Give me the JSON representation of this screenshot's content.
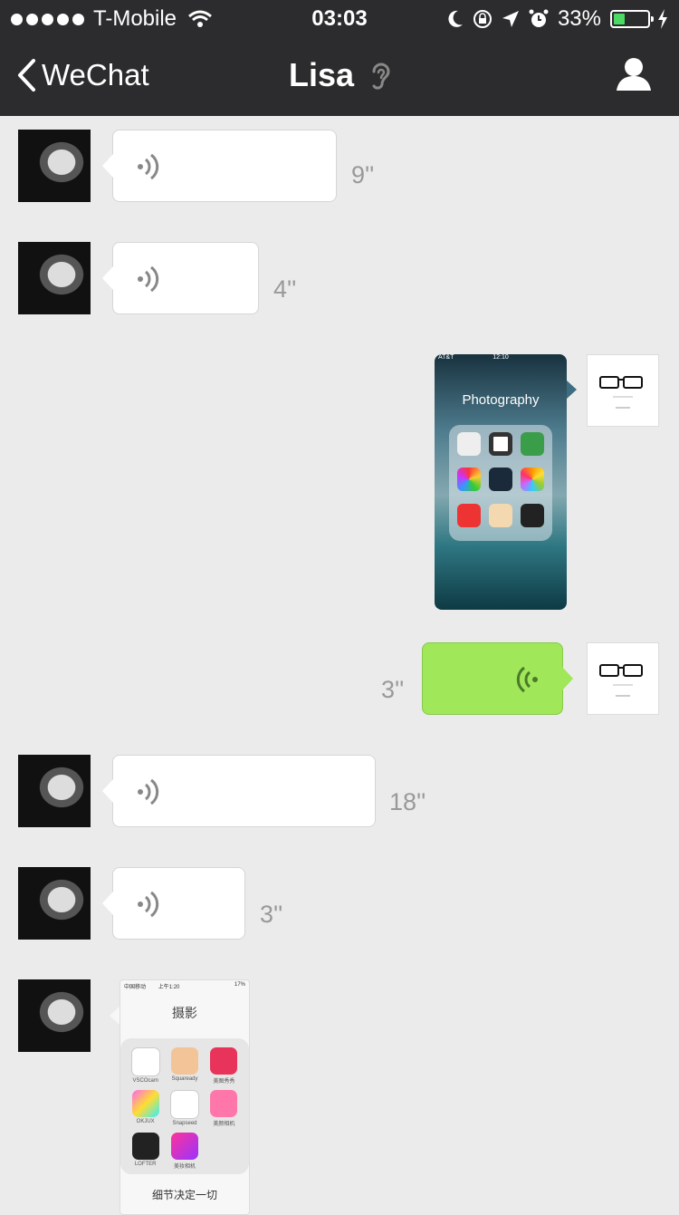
{
  "status_bar": {
    "carrier": "T-Mobile",
    "time": "03:03",
    "battery_percent": "33%",
    "battery_level": 0.33
  },
  "nav": {
    "back_label": "WeChat",
    "title": "Lisa"
  },
  "colors": {
    "nav_bg": "#2c2c2e",
    "chat_bg": "#ebebeb",
    "outgoing_bubble": "#a0e75a",
    "incoming_bubble": "#ffffff"
  },
  "messages": [
    {
      "sender": "Lisa",
      "type": "voice",
      "duration": "9''"
    },
    {
      "sender": "Lisa",
      "type": "voice",
      "duration": "4''"
    },
    {
      "sender": "me",
      "type": "image",
      "image": {
        "title": "Photography",
        "carrier": "AT&T",
        "time": "12:10"
      }
    },
    {
      "sender": "me",
      "type": "voice",
      "duration": "3''"
    },
    {
      "sender": "Lisa",
      "type": "voice",
      "duration": "18''"
    },
    {
      "sender": "Lisa",
      "type": "voice",
      "duration": "3''"
    },
    {
      "sender": "Lisa",
      "type": "image",
      "image": {
        "carrier": "中国移动",
        "time": "上午1:20",
        "battery": "17%",
        "title": "摄影",
        "apps": [
          "VSCOcam",
          "Squaready",
          "美图秀秀",
          "OKJUX",
          "Snapseed",
          "美颜相机",
          "LOFTER",
          "美妆相机"
        ],
        "caption": "细节决定一切"
      }
    }
  ],
  "icons": [
    "wifi-icon",
    "moon-icon",
    "rotation-lock-icon",
    "location-arrow-icon",
    "alarm-icon",
    "battery-icon",
    "charging-bolt-icon",
    "back-chevron-icon",
    "ear-icon",
    "profile-icon",
    "voice-wave-icon"
  ]
}
